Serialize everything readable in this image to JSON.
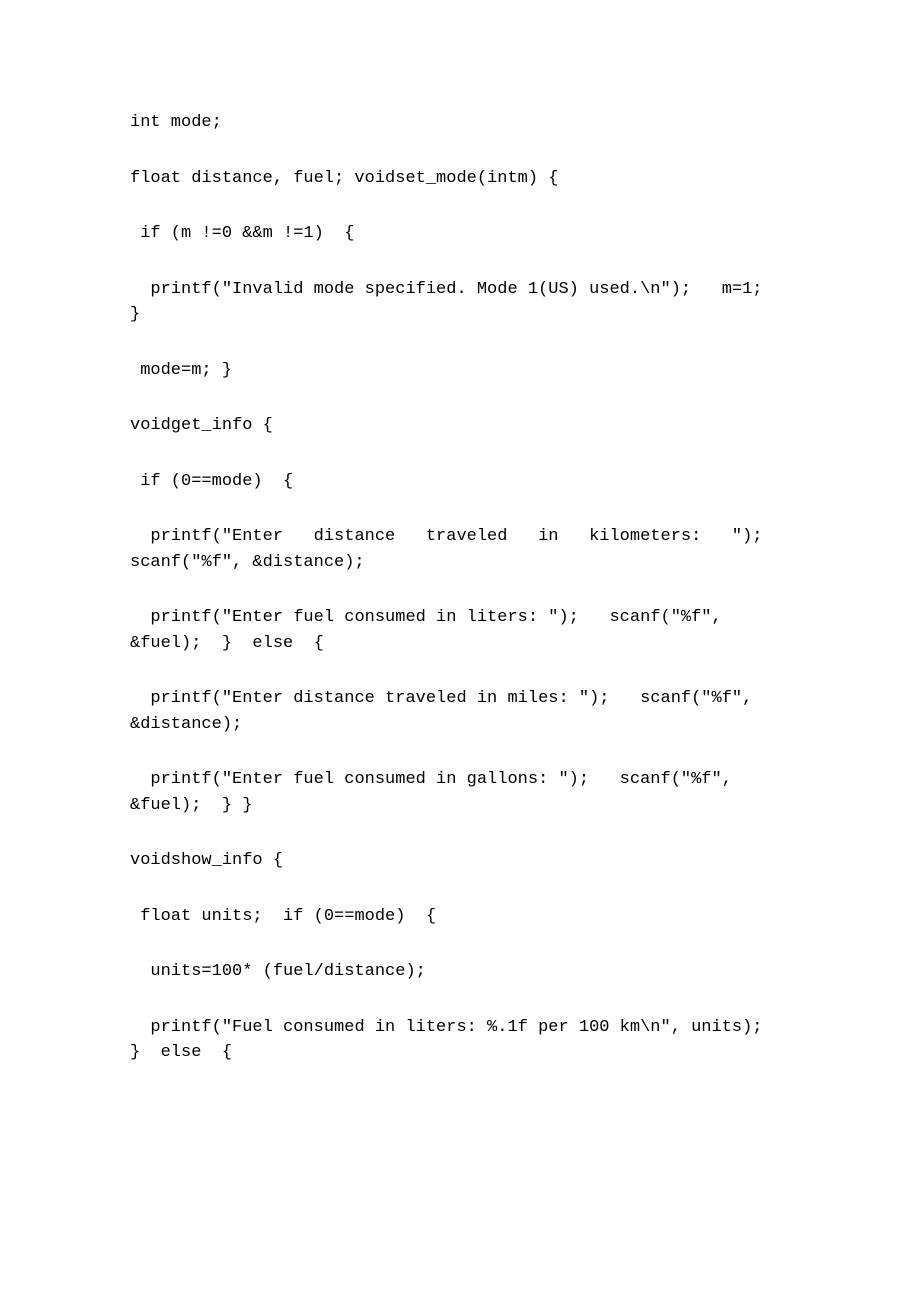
{
  "lines": [
    "int mode;",
    "float distance, fuel; voidset_mode(intm) {",
    " if (m !=0 &&m !=1)  {",
    "  printf(\"Invalid mode specified. Mode 1(US) used.\\n\");   m=1;  }",
    " mode=m; }",
    "voidget_info {",
    " if (0==mode)  {",
    "  printf(\"Enter   distance   traveled   in   kilometers:   \");   scanf(\"%f\", &distance);",
    "  printf(\"Enter fuel consumed in liters: \");   scanf(\"%f\", &fuel);  }  else  {",
    "  printf(\"Enter distance traveled in miles: \");   scanf(\"%f\", &distance);",
    "  printf(\"Enter fuel consumed in gallons: \");   scanf(\"%f\", &fuel);  } }",
    "voidshow_info {",
    " float units;  if (0==mode)  {",
    "  units=100* (fuel/distance);",
    "  printf(\"Fuel consumed in liters: %.1f per 100 km\\n\", units);  }  else  {"
  ]
}
